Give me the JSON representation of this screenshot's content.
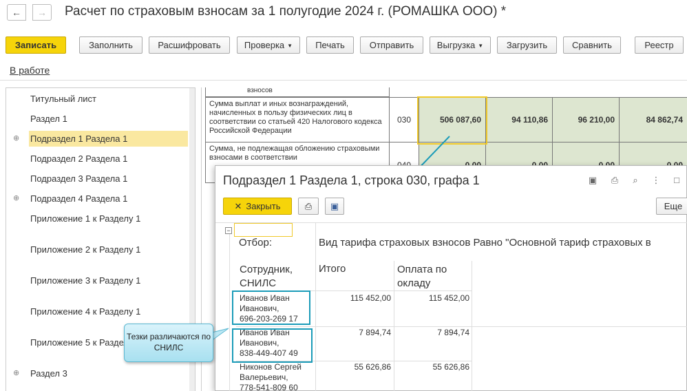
{
  "header": {
    "back": "←",
    "forward": "→",
    "title": "Расчет по страховым взносам за 1 полугодие 2024 г. (РОМАШКА ООО) *"
  },
  "toolbar": {
    "save": "Записать",
    "fill": "Заполнить",
    "decode": "Расшифровать",
    "check": "Проверка",
    "print": "Печать",
    "send": "Отправить",
    "export": "Выгрузка",
    "load": "Загрузить",
    "compare": "Сравнить",
    "registry": "Реестр"
  },
  "status": "В работе",
  "tree": [
    {
      "label": "Титульный лист",
      "expandable": false
    },
    {
      "label": "Раздел 1",
      "expandable": false
    },
    {
      "label": "Подраздел 1 Раздела 1",
      "expandable": true,
      "selected": true
    },
    {
      "label": "Подраздел 2 Раздела 1",
      "expandable": false
    },
    {
      "label": "Подраздел 3 Раздела 1",
      "expandable": false
    },
    {
      "label": "Подраздел 4 Раздела 1",
      "expandable": true
    },
    {
      "label": "Приложение 1 к Разделу 1",
      "expandable": false
    },
    {
      "label": "Приложение 2 к Разделу 1",
      "expandable": false
    },
    {
      "label": "Приложение 3 к Разделу 1",
      "expandable": false
    },
    {
      "label": "Приложение 4 к Разделу 1",
      "expandable": false
    },
    {
      "label": "Приложение 5 к Разделу 1",
      "expandable": false
    },
    {
      "label": "Раздел 3",
      "expandable": true
    }
  ],
  "grid": {
    "row030_label": "Сумма выплат и иных вознаграждений, начисленных в пользу физических лиц в соответствии со статьей 420 Налогового кодекса Российской Федерации",
    "row030_code": "030",
    "row030_values": [
      "506 087,60",
      "94 110,86",
      "96 210,00",
      "84 862,74"
    ],
    "row040_label": "Сумма, не подлежащая обложению страховыми взносами в соответствии",
    "row040_code": "040",
    "row040_values": [
      "0,00",
      "0,00",
      "0,00",
      "0,00"
    ],
    "top_fragment": "взносов"
  },
  "popup": {
    "title": "Подраздел 1 Раздела 1, строка 030, графа 1",
    "close": "Закрыть",
    "more": "Еще",
    "filter_label": "Отбор:",
    "filter_value": "Вид тарифа страховых взносов Равно \"Основной тариф страховых в",
    "col_employee": "Сотрудник, СНИЛС",
    "col_total": "Итого",
    "col_salary": "Оплата по окладу",
    "rows": [
      {
        "name": "Иванов Иван Иванович,",
        "snils": "696-203-269 17",
        "total": "115 452,00",
        "salary": "115 452,00"
      },
      {
        "name": "Иванов Иван Иванович,",
        "snils": "838-449-407 49",
        "total": "7 894,74",
        "salary": "7 894,74"
      },
      {
        "name": "Никонов Сергей Валерьевич,",
        "snils": "778-541-809 60",
        "total": "55 626,86",
        "salary": "55 626,86"
      }
    ]
  },
  "callout": "Тезки различаются по СНИЛС"
}
